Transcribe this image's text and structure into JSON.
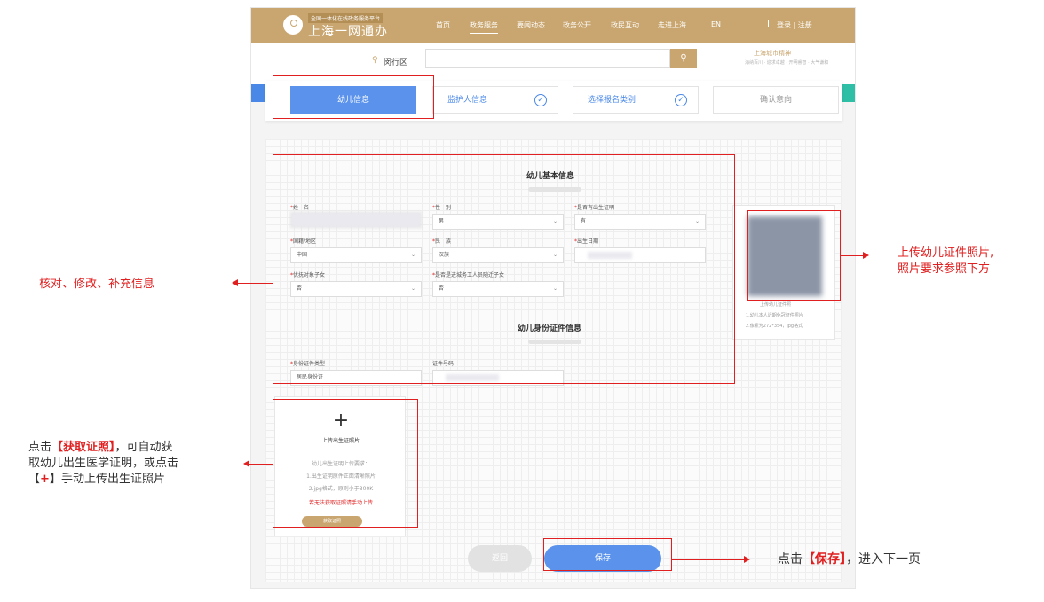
{
  "header": {
    "logo_subtitle": "全国一体化在线政务服务平台",
    "logo_title": "上海一网通办",
    "nav": [
      "首页",
      "政务服务",
      "要闻动态",
      "政务公开",
      "政民互动",
      "走进上海",
      "EN"
    ],
    "login": "登录 | 注册"
  },
  "search": {
    "district": "闵行区",
    "city_title": "上海城市精神",
    "city_sub": "海纳百川 · 追求卓越 · 开明睿智 · 大气谦和"
  },
  "steps": [
    {
      "label": "幼儿信息"
    },
    {
      "label": "监护人信息"
    },
    {
      "label": "选择报名类别"
    },
    {
      "label": "确认意向"
    }
  ],
  "form": {
    "basic_title": "幼儿基本信息",
    "fields": {
      "name": {
        "label": "姓　名"
      },
      "gender": {
        "label": "性　别",
        "value": "男"
      },
      "has_birth_cert": {
        "label": "是否有出生证明",
        "value": "有"
      },
      "nationality": {
        "label": "国籍/地区",
        "value": "中国"
      },
      "ethnicity": {
        "label": "民　族",
        "value": "汉族"
      },
      "birthday": {
        "label": "出生日期"
      },
      "preferential": {
        "label": "优抚对象子女",
        "value": "否"
      },
      "migrant": {
        "label": "是否是进城务工人员随迁子女",
        "value": "否"
      }
    },
    "id_title": "幼儿身份证件信息",
    "id_fields": {
      "id_type": {
        "label": "身份证件类型",
        "value": "居民身份证"
      },
      "id_number": {
        "label": "证件号码"
      }
    }
  },
  "photo": {
    "caption": "上传幼儿证件照",
    "rule1": "1.幼儿本人近期免冠证件照片",
    "rule2": "2.像素为272*354，jpg格式"
  },
  "birth_cert": {
    "plus": "+",
    "title": "上传出生证照片",
    "req_title": "幼儿出生证明上传要求：",
    "req1": "1.出生证明原件正面清晰照片",
    "req2": "2.jpg格式，原则小于300K",
    "warn": "若无法获取证照请手动上传",
    "button": "获取证照"
  },
  "buttons": {
    "back": "返回",
    "save": "保存"
  },
  "annotations": {
    "left_middle": "核对、修改、补充信息",
    "right_photo_1": "上传幼儿证件照片,",
    "right_photo_2": "照片要求参照下方",
    "left_bottom_p1": "点击",
    "left_bottom_b1": "【获取证照】",
    "left_bottom_p2": "，可自动获",
    "left_bottom_line2": "取幼儿出生医学证明，或点击",
    "left_bottom_b2a": "【",
    "left_bottom_b2b": "+",
    "left_bottom_b2c": "】",
    "left_bottom_p3": "手动上传出生证照片",
    "save_p1": "点击",
    "save_b": "【保存】",
    "save_p2": "，进入下一页"
  },
  "colors": {
    "gold": "#c9a66f",
    "blue": "#5b93ec",
    "red": "#e02020"
  }
}
